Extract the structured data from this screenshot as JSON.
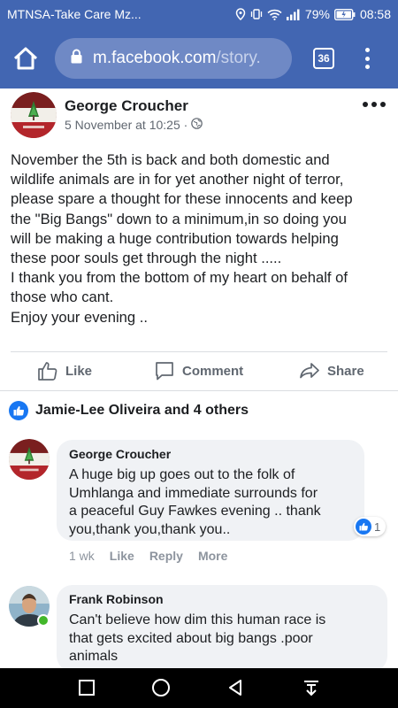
{
  "status_bar": {
    "carrier": "MTNSA-Take Care Mz...",
    "battery": "79%",
    "time": "08:58"
  },
  "browser": {
    "url_host": "m.facebook.com",
    "url_path": "/story.",
    "tab_count": "36"
  },
  "post": {
    "author": "George Croucher",
    "date": "5 November at 10:25 ·",
    "text_lines": [
      "November the 5th is back and both domestic and",
      "wildlife animals are in for yet another night of terror,",
      "please spare a thought for these innocents and keep",
      "the \"Big Bangs\" down to a minimum,in so doing you",
      "will be making a huge contribution towards helping",
      "these poor souls get through the night .....",
      "I thank you from the bottom of my heart on behalf of",
      "those who cant.",
      "Enjoy your evening .."
    ],
    "actions": {
      "like": "Like",
      "comment": "Comment",
      "share": "Share"
    },
    "reactions_text": "Jamie-Lee Oliveira and 4 others"
  },
  "comments": [
    {
      "author": "George Croucher",
      "text_lines": [
        "A huge big up goes out to the folk of",
        "Umhlanga and immediate surrounds for",
        "a peaceful Guy Fawkes evening .. thank",
        "you,thank you,thank you.."
      ],
      "reaction_count": "1",
      "age": "1 wk",
      "like_label": "Like",
      "reply_label": "Reply",
      "more_label": "More"
    },
    {
      "author": "Frank Robinson",
      "text_lines": [
        "Can't believe how dim this human race is",
        "that gets excited about big bangs .poor",
        "animals"
      ]
    }
  ],
  "colors": {
    "brand": "#4266b2",
    "like_blue": "#1877f2",
    "online": "#42b72a"
  }
}
